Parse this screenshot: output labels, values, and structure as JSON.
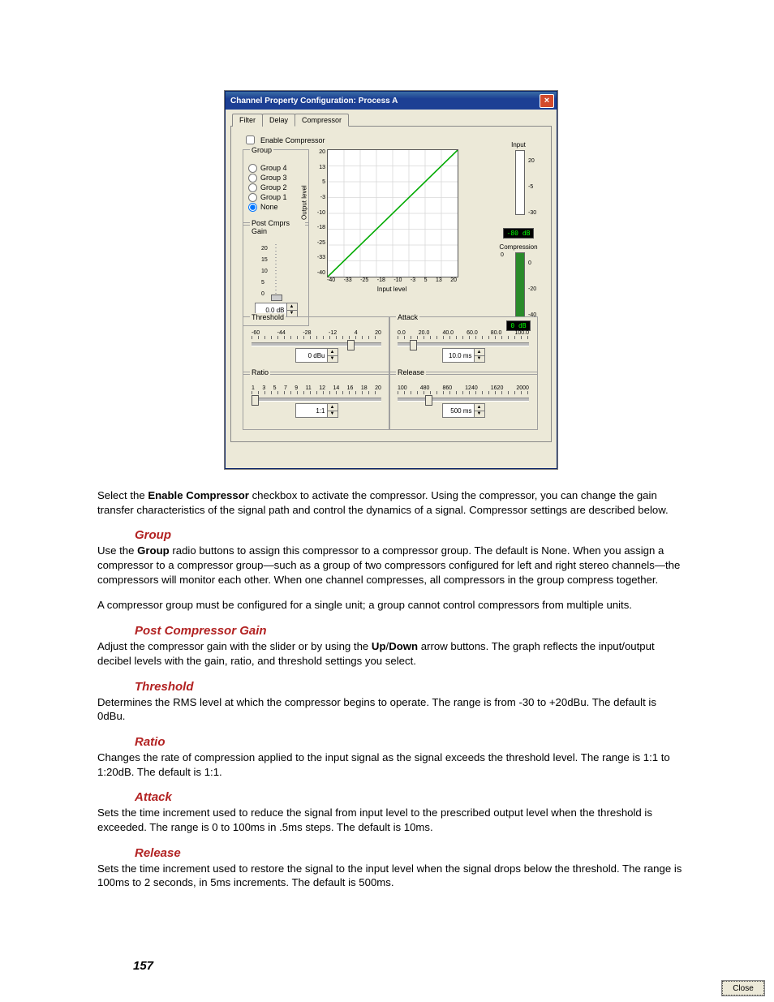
{
  "dialog": {
    "title": "Channel Property Configuration: Process A",
    "close_label": "Close",
    "x_label": "×",
    "tabs": {
      "filter": "Filter",
      "delay": "Delay",
      "compressor": "Compressor"
    },
    "enable_label": "Enable Compressor",
    "group": {
      "legend": "Group",
      "options": [
        "Group 4",
        "Group 3",
        "Group 2",
        "Group 1",
        "None"
      ],
      "selected": "None"
    },
    "post_gain": {
      "legend": "Post Cmprs Gain",
      "ticks": [
        "20",
        "15",
        "10",
        "5",
        "0"
      ],
      "value": "0.0 dB"
    },
    "graph": {
      "ylabel": "Output level",
      "xlabel": "Input level",
      "xticks": [
        "-40",
        "-33",
        "-25",
        "-18",
        "-10",
        "-3",
        "5",
        "13",
        "20"
      ],
      "yticks": [
        "20",
        "13",
        "5",
        "-3",
        "-10",
        "-18",
        "-25",
        "-33",
        "-40"
      ]
    },
    "meters": {
      "input_label": "Input",
      "input_ticks": [
        "20",
        "-5",
        "-30"
      ],
      "input_value": "-80 dB",
      "comp_label": "Compression",
      "comp_ticks": [
        "0",
        "-20",
        "-40"
      ],
      "comp_value": "0 dB",
      "comp_left": "0"
    },
    "threshold": {
      "legend": "Threshold",
      "ticks": [
        "-60",
        "-44",
        "-28",
        "-12",
        "4",
        "20"
      ],
      "value": "0 dBu"
    },
    "ratio": {
      "legend": "Ratio",
      "ticks": [
        "1",
        "3",
        "5",
        "7",
        "9",
        "11",
        "12",
        "14",
        "16",
        "18",
        "20"
      ],
      "value": "1:1"
    },
    "attack": {
      "legend": "Attack",
      "ticks": [
        "0.0",
        "20.0",
        "40.0",
        "60.0",
        "80.0",
        "100.0"
      ],
      "value": "10.0 ms"
    },
    "release": {
      "legend": "Release",
      "ticks": [
        "100",
        "480",
        "860",
        "1240",
        "1620",
        "2000"
      ],
      "value": "500 ms"
    }
  },
  "copy": {
    "intro_a": "Select the ",
    "intro_b": "Enable Compressor",
    "intro_c": " checkbox to activate the compressor. Using the compressor, you can change the gain transfer characteristics of the signal path and control the dynamics of a signal. Compressor settings are described below.",
    "group_h": "Group",
    "group_a": "Use the ",
    "group_b": "Group",
    "group_c": " radio buttons to assign this compressor to a compressor group. The default is None. When you assign a compressor to a compressor group—such as a group of two compressors configured for left and right stereo channels—the compressors will monitor each other. When one channel compresses, all compressors in the group compress together.",
    "group_p2": "A compressor group must be configured for a single unit; a group cannot control compressors from multiple units.",
    "post_h": "Post Compressor Gain",
    "post_a": "Adjust the compressor gain with the slider or by using the ",
    "post_b": "Up",
    "post_c": "/",
    "post_d": "Down",
    "post_e": " arrow buttons. The graph reflects the input/output decibel levels with the gain, ratio, and threshold settings you select.",
    "thr_h": "Threshold",
    "thr_p": "Determines the RMS level at which the compressor begins to operate. The range is from -30 to +20dBu. The default is 0dBu.",
    "rat_h": "Ratio",
    "rat_p": "Changes the rate of compression applied to the input signal as the signal exceeds the threshold level. The range is 1:1 to 1:20dB. The default is 1:1.",
    "atk_h": "Attack",
    "atk_p": "Sets the time increment used to reduce the signal from input level to the prescribed output level when the threshold is exceeded.  The range is 0 to 100ms in .5ms steps. The default is 10ms.",
    "rel_h": "Release",
    "rel_p": "Sets the time increment used to restore the signal to the input level when the signal drops below the threshold. The range is 100ms to 2 seconds, in 5ms increments. The default is 500ms."
  },
  "page_number": "157",
  "chart_data": {
    "type": "line",
    "title": "",
    "xlabel": "Input level",
    "ylabel": "Output level",
    "xlim": [
      -40,
      20
    ],
    "ylim": [
      -40,
      20
    ],
    "x": [
      -40,
      -33,
      -25,
      -18,
      -10,
      -3,
      5,
      13,
      20
    ],
    "y": [
      -40,
      -33,
      -25,
      -18,
      -10,
      -3,
      5,
      13,
      20
    ]
  }
}
